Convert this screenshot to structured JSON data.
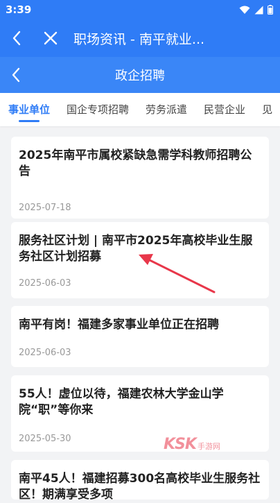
{
  "status": {
    "time": "3:39"
  },
  "browser": {
    "title": "职场资讯 - 南平就业..."
  },
  "header": {
    "title": "政企招聘"
  },
  "tabs": [
    {
      "label": "事业单位"
    },
    {
      "label": "国企专项招聘"
    },
    {
      "label": "劳务派遣"
    },
    {
      "label": "民营企业"
    },
    {
      "label": "见"
    }
  ],
  "articles": [
    {
      "title": "2025年南平市属校紧缺急需学科教师招聘公告",
      "date": "2025-07-18"
    },
    {
      "title": "服务社区计划 | 南平市2025年高校毕业生服务社区计划招募",
      "date": "2025-06-03"
    },
    {
      "title": "南平有岗！福建多家事业单位正在招聘",
      "date": "2025-06-03"
    },
    {
      "title": "55人！虚位以待，福建农林大学金山学院“职”等你来",
      "date": "2025-05-30"
    },
    {
      "title": "南平45人！福建招募300名高校毕业生服务社区！期满享受多项",
      "date": ""
    }
  ],
  "watermark": {
    "brand": "KSK",
    "tagline": "手游网"
  },
  "colors": {
    "primary": "#2f7cf6",
    "header": "#3a86f7",
    "annotation": "#e8374a"
  }
}
